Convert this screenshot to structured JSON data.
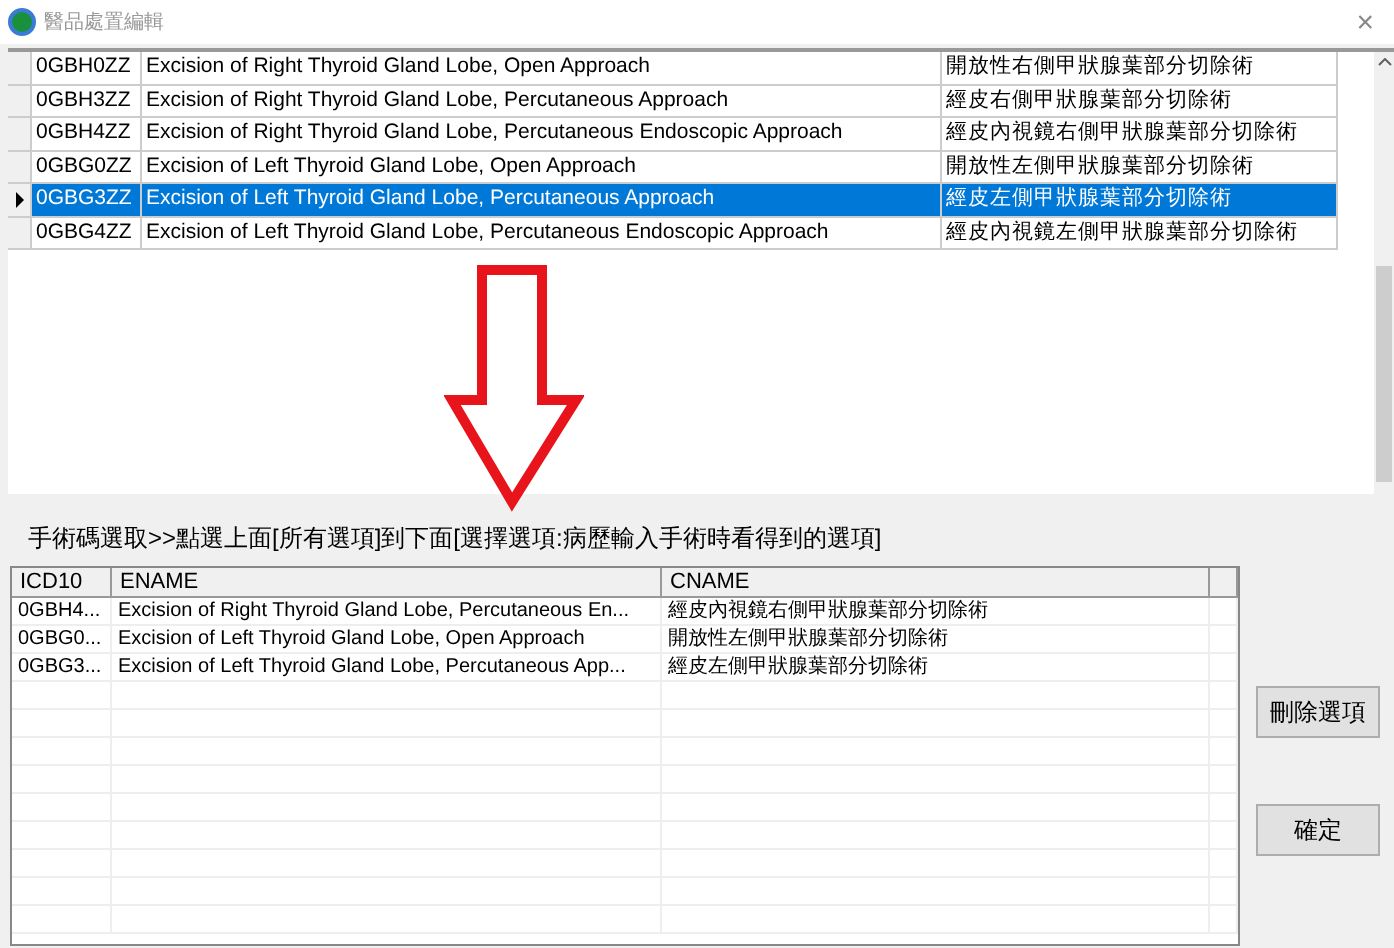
{
  "window": {
    "title": "醫品處置編輯",
    "close": "×"
  },
  "upper_table": {
    "rows": [
      {
        "code": "0GBH0ZZ",
        "ename": "Excision of Right Thyroid Gland Lobe, Open Approach",
        "cname": "開放性右側甲狀腺葉部分切除術",
        "selected": false
      },
      {
        "code": "0GBH3ZZ",
        "ename": "Excision of Right Thyroid Gland Lobe, Percutaneous Approach",
        "cname": "經皮右側甲狀腺葉部分切除術",
        "selected": false
      },
      {
        "code": "0GBH4ZZ",
        "ename": "Excision of Right Thyroid Gland Lobe, Percutaneous Endoscopic Approach",
        "cname": "經皮內視鏡右側甲狀腺葉部分切除術",
        "selected": false
      },
      {
        "code": "0GBG0ZZ",
        "ename": "Excision of Left Thyroid Gland Lobe, Open Approach",
        "cname": "開放性左側甲狀腺葉部分切除術",
        "selected": false
      },
      {
        "code": "0GBG3ZZ",
        "ename": "Excision of Left Thyroid Gland Lobe, Percutaneous Approach",
        "cname": "經皮左側甲狀腺葉部分切除術",
        "selected": true
      },
      {
        "code": "0GBG4ZZ",
        "ename": "Excision of Left Thyroid Gland Lobe, Percutaneous Endoscopic Approach",
        "cname": "經皮內視鏡左側甲狀腺葉部分切除術",
        "selected": false
      }
    ]
  },
  "instruction": "手術碼選取>>點選上面[所有選項]到下面[選擇選項:病歷輸入手術時看得到的選項]",
  "lower_table": {
    "columns": [
      "ICD10",
      "ENAME",
      "CNAME"
    ],
    "rows": [
      [
        "0GBH4...",
        "Excision of Right Thyroid Gland Lobe, Percutaneous En...",
        "經皮內視鏡右側甲狀腺葉部分切除術"
      ],
      [
        "0GBG0...",
        "Excision of Left Thyroid Gland Lobe, Open Approach",
        "開放性左側甲狀腺葉部分切除術"
      ],
      [
        "0GBG3...",
        "Excision of Left Thyroid Gland Lobe, Percutaneous App...",
        "經皮左側甲狀腺葉部分切除術"
      ]
    ]
  },
  "buttons": {
    "delete": "刪除選項",
    "ok": "確定"
  }
}
